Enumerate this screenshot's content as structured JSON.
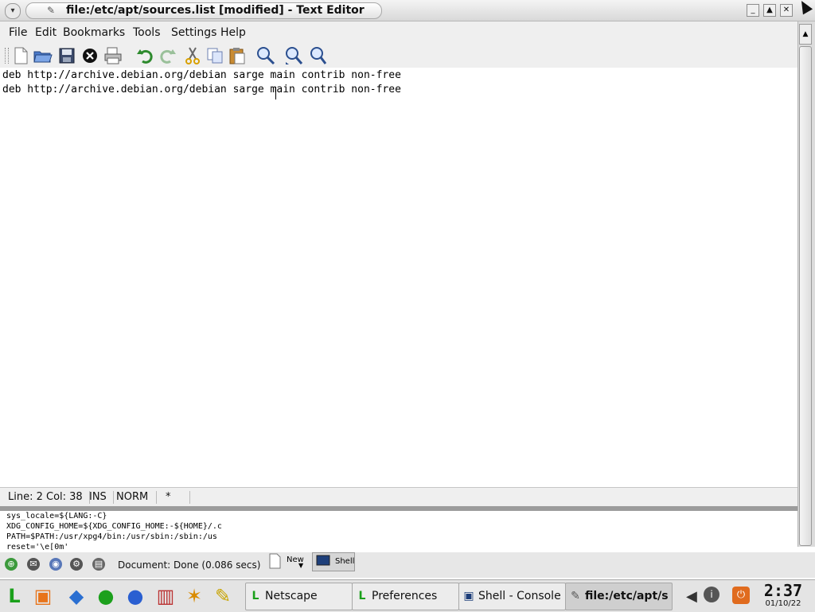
{
  "window": {
    "title": "file:/etc/apt/sources.list [modified] - Text Editor",
    "menu_icon": "chevron-down-icon",
    "buttons": {
      "minimize": "minimize-icon",
      "maximize": "maximize-icon",
      "close": "close-icon"
    }
  },
  "menubar": {
    "items": [
      {
        "label": "File"
      },
      {
        "label": "Edit"
      },
      {
        "label": "Bookmarks"
      },
      {
        "label": "Tools"
      },
      {
        "label": "Settings"
      },
      {
        "label": "Help"
      }
    ]
  },
  "toolbar": {
    "icons": [
      "new-icon",
      "open-icon",
      "save-icon",
      "close-doc-icon",
      "print-icon",
      "undo-icon",
      "redo-icon",
      "cut-icon",
      "copy-icon",
      "paste-icon",
      "find-icon",
      "find-next-icon",
      "find-previous-icon"
    ]
  },
  "editor": {
    "lines": [
      "deb http://archive.debian.org/debian sarge main contrib non-free",
      "deb http://archive.debian.org/debian sarge main contrib non-free"
    ],
    "cursor": {
      "line": 2,
      "col": 38
    }
  },
  "statusbar": {
    "position": "Line: 2 Col: 38",
    "insert_mode": "INS",
    "selection_mode": "NORM",
    "modified": "*"
  },
  "terminal": {
    "lines": [
      "sys_locale=${LANG:-C}",
      "XDG_CONFIG_HOME=${XDG_CONFIG_HOME:-${HOME}/.c",
      "PATH=$PATH:/usr/xpg4/bin:/usr/sbin:/sbin:/us",
      "reset='\\e[0m'"
    ]
  },
  "panel": {
    "status_message": "Document: Done (0.086 secs)",
    "new_label": "New",
    "shell_label": "Shell"
  },
  "taskbar": {
    "tasks": [
      {
        "label": "Netscape"
      },
      {
        "label": "Preferences"
      },
      {
        "label": "Shell - Console"
      },
      {
        "label": "file:/etc/apt/s"
      }
    ],
    "clock": {
      "time": "2:37",
      "date": "01/10/22"
    }
  }
}
